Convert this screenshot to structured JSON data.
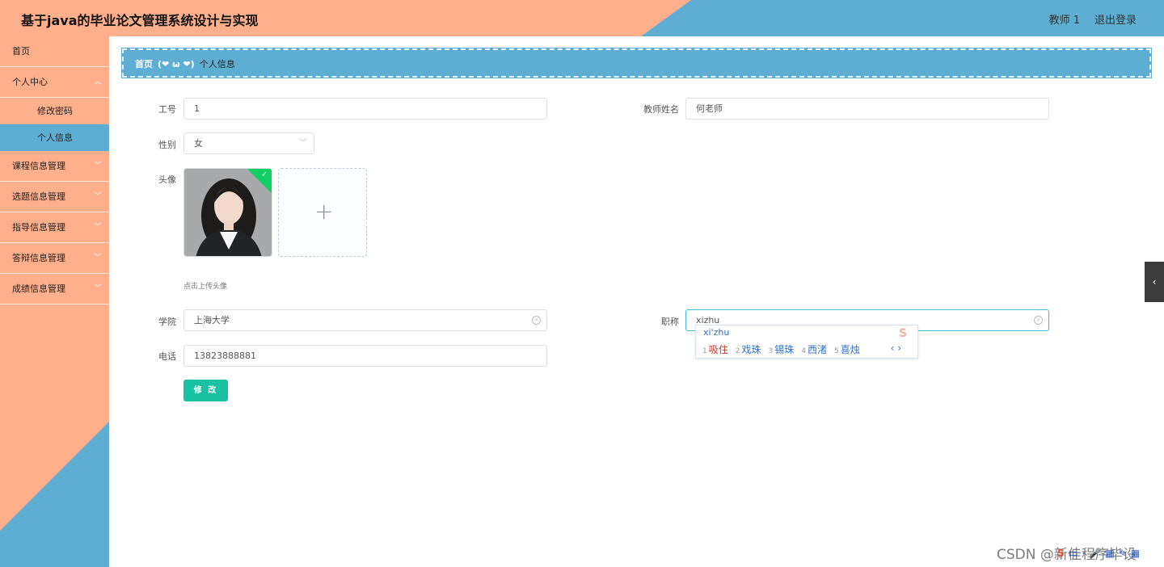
{
  "header": {
    "title": "基于java的毕业论文管理系统设计与实现",
    "user_label": "教师 1",
    "logout_label": "退出登录"
  },
  "sidebar": {
    "home": "首页",
    "personal_center": "个人中心",
    "change_password": "修改密码",
    "personal_info": "个人信息",
    "items": [
      "课程信息管理",
      "选题信息管理",
      "指导信息管理",
      "答辩信息管理",
      "成绩信息管理"
    ]
  },
  "breadcrumb": {
    "home": "首页",
    "separator": "(❤ ω ❤)",
    "current": "个人信息"
  },
  "form": {
    "job_number_label": "工号",
    "job_number_value": "1",
    "teacher_name_label": "教师姓名",
    "teacher_name_value": "何老师",
    "gender_label": "性别",
    "gender_value": "女",
    "avatar_label": "头像",
    "upload_hint": "点击上传头像",
    "college_label": "学院",
    "college_value": "上海大学",
    "title_label": "职称",
    "title_value": "xizhu",
    "phone_label": "电话",
    "phone_value": "13823888881",
    "submit_label": "修 改"
  },
  "ime": {
    "composition": "xi'zhu",
    "candidates": [
      {
        "num": "1",
        "text": "吸住"
      },
      {
        "num": "2",
        "text": "戏珠"
      },
      {
        "num": "3",
        "text": "锡珠"
      },
      {
        "num": "4",
        "text": "西渚"
      },
      {
        "num": "5",
        "text": "喜烛"
      }
    ],
    "nav": "‹ ›",
    "logo": "S"
  },
  "watermark": "CSDN @新佳程序毕设",
  "tray": {
    "logo": "S",
    "items": [
      "中",
      "·",
      "🎤",
      "▦",
      "✎",
      "▦"
    ]
  },
  "colors": {
    "header_left": "#ffaf8c",
    "header_right": "#5eaed4",
    "sidebar": "#ffaf8c",
    "active_menu": "#5eaed4",
    "submit_button": "#19c2a0",
    "avatar_check": "#13ce66"
  }
}
